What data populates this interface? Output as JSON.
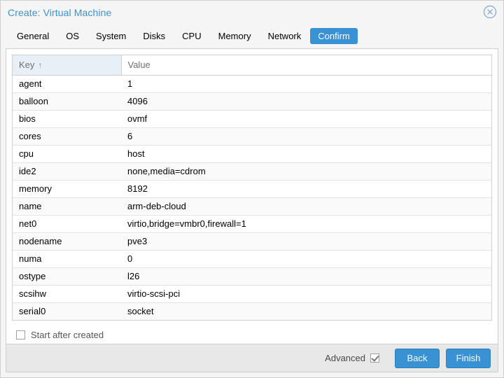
{
  "window": {
    "title": "Create: Virtual Machine",
    "close_icon": "close-circle-icon"
  },
  "tabs": [
    {
      "label": "General",
      "active": false
    },
    {
      "label": "OS",
      "active": false
    },
    {
      "label": "System",
      "active": false
    },
    {
      "label": "Disks",
      "active": false
    },
    {
      "label": "CPU",
      "active": false
    },
    {
      "label": "Memory",
      "active": false
    },
    {
      "label": "Network",
      "active": false
    },
    {
      "label": "Confirm",
      "active": true
    }
  ],
  "grid": {
    "columns": [
      {
        "label": "Key",
        "sorted": true,
        "sort_direction": "asc",
        "sort_glyph": "↑"
      },
      {
        "label": "Value",
        "sorted": false
      }
    ],
    "rows": [
      {
        "key": "agent",
        "value": "1"
      },
      {
        "key": "balloon",
        "value": "4096"
      },
      {
        "key": "bios",
        "value": "ovmf"
      },
      {
        "key": "cores",
        "value": "6"
      },
      {
        "key": "cpu",
        "value": "host"
      },
      {
        "key": "ide2",
        "value": "none,media=cdrom"
      },
      {
        "key": "memory",
        "value": "8192"
      },
      {
        "key": "name",
        "value": "arm-deb-cloud"
      },
      {
        "key": "net0",
        "value": "virtio,bridge=vmbr0,firewall=1"
      },
      {
        "key": "nodename",
        "value": "pve3"
      },
      {
        "key": "numa",
        "value": "0"
      },
      {
        "key": "ostype",
        "value": "l26"
      },
      {
        "key": "scsihw",
        "value": "virtio-scsi-pci"
      },
      {
        "key": "serial0",
        "value": "socket"
      }
    ]
  },
  "options": {
    "start_after_created_label": "Start after created",
    "start_after_created_checked": false
  },
  "footer": {
    "advanced_label": "Advanced",
    "advanced_checked": true,
    "back_label": "Back",
    "finish_label": "Finish"
  },
  "colors": {
    "accent": "#3892d4",
    "title_text": "#3892d4",
    "sorted_header_bg": "#e8f0f7",
    "footer_bg": "#e8e8e8",
    "row_alt_bg": "#fafafa"
  }
}
